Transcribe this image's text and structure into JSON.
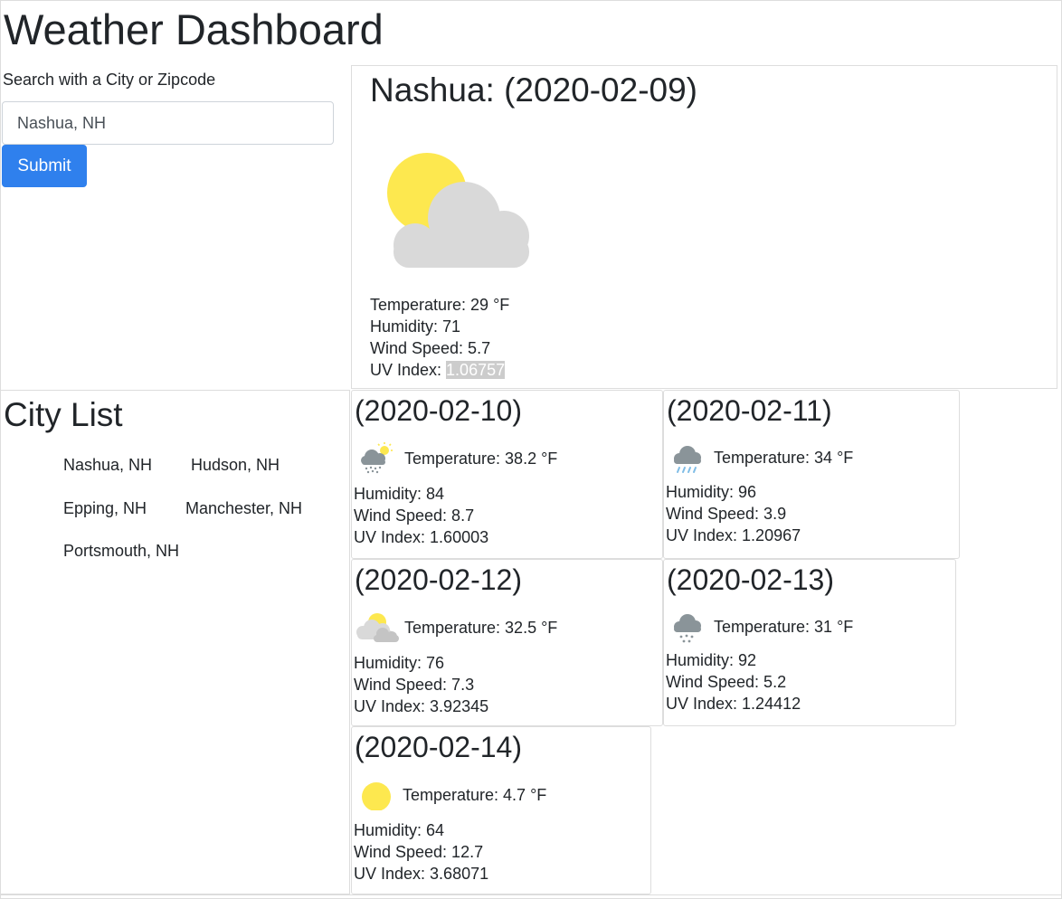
{
  "header": {
    "title": "Weather Dashboard"
  },
  "search": {
    "label": "Search with a City or Zipcode",
    "value": "Nashua, NH",
    "submit_label": "Submit"
  },
  "current": {
    "heading": "Nashua: (2020-02-09)",
    "icon": "partly-cloudy-icon",
    "temperature": "Temperature: 29 °F",
    "humidity": "Humidity: 71",
    "wind": "Wind Speed: 5.7",
    "uv_label": "UV Index: ",
    "uv_value": "1.06757",
    "uv_color": "#cccccc"
  },
  "city_list": {
    "heading": "City List",
    "cities": [
      "Nashua, NH",
      "Hudson, NH",
      "Epping, NH",
      "Manchester, NH",
      "Portsmouth, NH"
    ]
  },
  "forecast": [
    {
      "date": "(2020-02-10)",
      "icon": "snow-sun-icon",
      "temperature": "Temperature: 38.2 °F",
      "humidity": "Humidity: 84",
      "wind": "Wind Speed: 8.7",
      "uv": "UV Index: 1.60003"
    },
    {
      "date": "(2020-02-11)",
      "icon": "rain-cloud-icon",
      "temperature": "Temperature: 34 °F",
      "humidity": "Humidity: 96",
      "wind": "Wind Speed: 3.9",
      "uv": "UV Index: 1.20967"
    },
    {
      "date": "(2020-02-12)",
      "icon": "partly-cloudy-icon",
      "temperature": "Temperature: 32.5 °F",
      "humidity": "Humidity: 76",
      "wind": "Wind Speed: 7.3",
      "uv": "UV Index: 3.92345"
    },
    {
      "date": "(2020-02-13)",
      "icon": "snow-cloud-icon",
      "temperature": "Temperature: 31 °F",
      "humidity": "Humidity: 92",
      "wind": "Wind Speed: 5.2",
      "uv": "UV Index: 1.24412"
    },
    {
      "date": "(2020-02-14)",
      "icon": "sun-icon",
      "temperature": "Temperature: 4.7 °F",
      "humidity": "Humidity: 64",
      "wind": "Wind Speed: 12.7",
      "uv": "UV Index: 3.68071"
    }
  ],
  "colors": {
    "accent": "#2f80ed",
    "sun": "#fde84f",
    "cloud_light": "#d9d9d9",
    "cloud_dark": "#8a9499",
    "rain": "#7fbde6"
  }
}
